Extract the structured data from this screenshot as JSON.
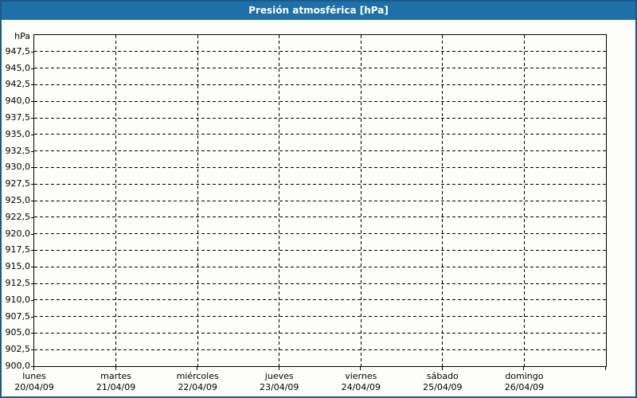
{
  "window": {
    "title": "Presión atmosférica [hPa]"
  },
  "colors": {
    "titlebar_bg": "#1f6fa8",
    "titlebar_text": "#ffffff",
    "frame_border": "#1a5a8c",
    "background": "#fdfef9",
    "grid": "#000000",
    "axis": "#000000",
    "label_text": "#000000"
  },
  "chart_data": {
    "type": "line",
    "title": "Presión atmosférica [hPa]",
    "ylabel": "hPa",
    "ylim": [
      900,
      950
    ],
    "ytick_step": 2.5,
    "ytick_values": [
      947.5,
      945.0,
      942.5,
      940.0,
      937.5,
      935.0,
      932.5,
      930.0,
      927.5,
      925.0,
      922.5,
      920.0,
      917.5,
      915.0,
      912.5,
      910.0,
      907.5,
      905.0,
      902.5,
      900.0
    ],
    "ytick_labels": [
      "947,5",
      "945,0",
      "942,5",
      "940,0",
      "937,5",
      "935,0",
      "932,5",
      "930,0",
      "927,5",
      "925,0",
      "922,5",
      "920,0",
      "917,5",
      "915,0",
      "912,5",
      "910,0",
      "907,5",
      "905,0",
      "902,5",
      "900,0"
    ],
    "x_categories": [
      {
        "day": "lunes",
        "date": "20/04/09"
      },
      {
        "day": "martes",
        "date": "21/04/09"
      },
      {
        "day": "miércoles",
        "date": "22/04/09"
      },
      {
        "day": "jueves",
        "date": "23/04/09"
      },
      {
        "day": "viernes",
        "date": "24/04/09"
      },
      {
        "day": "sábado",
        "date": "25/04/09"
      },
      {
        "day": "domingo",
        "date": "26/04/09"
      }
    ],
    "series": [],
    "grid": "dashed",
    "legend": "none"
  }
}
